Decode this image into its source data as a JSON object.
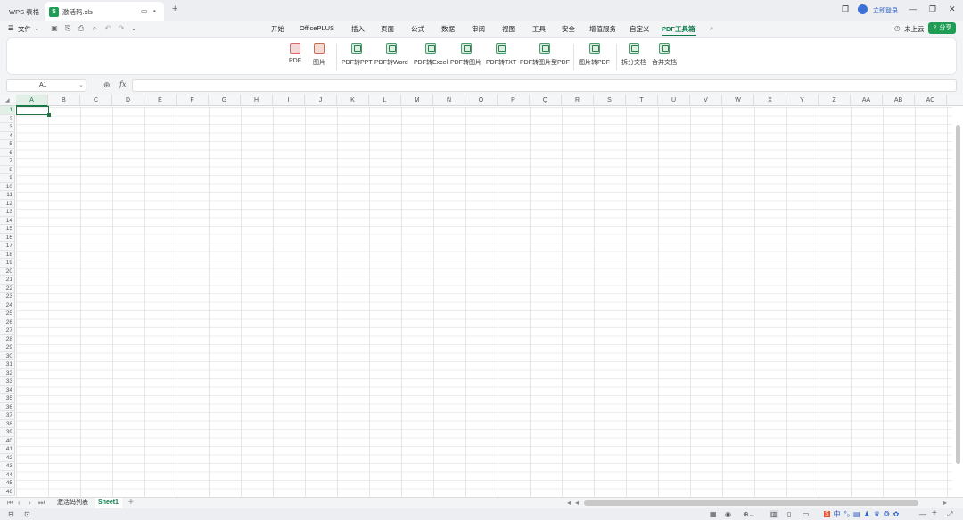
{
  "titlebar": {
    "home_tab": "WPS 表格",
    "file_tab": "激活码.xls",
    "file_badge": "S",
    "login_label": "立即登录"
  },
  "menubar": {
    "file_menu": "文件",
    "items": [
      "开始",
      "OfficePLUS",
      "插入",
      "页面",
      "公式",
      "数据",
      "审阅",
      "视图",
      "工具",
      "安全",
      "增值服务",
      "自定义",
      "PDF工具箱"
    ],
    "active": "PDF工具箱",
    "cloud_label": "未上云",
    "share_label": "分享"
  },
  "ribbon": {
    "buttons": [
      {
        "label": "PDF",
        "icon": "pdf-icon"
      },
      {
        "label": "图片",
        "icon": "image-icon"
      },
      {
        "label": "PDF转PPT",
        "icon": "pdf-to-ppt-icon"
      },
      {
        "label": "PDF转Word",
        "icon": "pdf-to-word-icon"
      },
      {
        "label": "PDF转Excel",
        "icon": "pdf-to-excel-icon"
      },
      {
        "label": "PDF转图片",
        "icon": "pdf-to-image-icon"
      },
      {
        "label": "PDF转TXT",
        "icon": "pdf-to-txt-icon"
      },
      {
        "label": "PDF转图片型PDF",
        "icon": "pdf-to-image-pdf-icon"
      },
      {
        "label": "图片转PDF",
        "icon": "image-to-pdf-icon"
      },
      {
        "label": "拆分文档",
        "icon": "split-doc-icon"
      },
      {
        "label": "合并文档",
        "icon": "merge-doc-icon"
      }
    ]
  },
  "formula": {
    "cell_ref": "A1",
    "fx": "fx"
  },
  "grid": {
    "columns": [
      "A",
      "B",
      "C",
      "D",
      "E",
      "F",
      "G",
      "H",
      "I",
      "J",
      "K",
      "L",
      "M",
      "N",
      "O",
      "P",
      "Q",
      "R",
      "S",
      "T",
      "U",
      "V",
      "W",
      "X",
      "Y",
      "Z",
      "AA",
      "AB",
      "AC"
    ],
    "rows": [
      "1",
      "2",
      "3",
      "4",
      "5",
      "6",
      "7",
      "8",
      "9",
      "10",
      "11",
      "12",
      "13",
      "14",
      "15",
      "16",
      "17",
      "18",
      "19",
      "20",
      "21",
      "22",
      "23",
      "24",
      "25",
      "26",
      "27",
      "28",
      "29",
      "30",
      "31",
      "32",
      "33",
      "34",
      "35",
      "36",
      "37",
      "38",
      "39",
      "40",
      "41",
      "42",
      "43",
      "44",
      "45",
      "46"
    ]
  },
  "sheets": {
    "tabs": [
      "激活码列表",
      "Sheet1"
    ],
    "active": "Sheet1"
  },
  "colors": {
    "accent": "#0f7b4a",
    "active_cell_border": "#217346"
  }
}
